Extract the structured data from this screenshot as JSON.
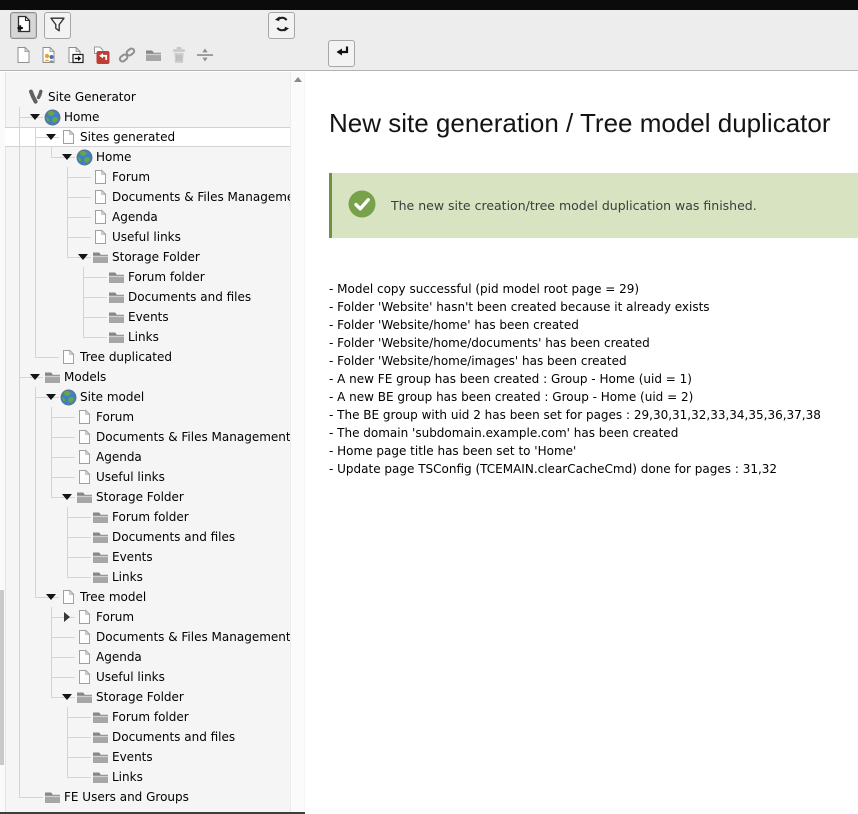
{
  "toolbar": {
    "primary_buttons": [
      {
        "icon": "new-page",
        "active": true
      },
      {
        "icon": "filter",
        "active": false
      }
    ],
    "refresh_button_icon": "refresh",
    "return_button_icon": "return",
    "drag_icons": [
      "page-plain",
      "page-content",
      "page-shortcut",
      "page-insert-red",
      "link",
      "folder",
      "trash",
      "separator"
    ]
  },
  "tree": {
    "items": [
      {
        "label": "Site Generator",
        "depth": 0,
        "icon": "typo3",
        "expander": "none",
        "selected": false
      },
      {
        "label": "Home",
        "depth": 1,
        "icon": "globe",
        "expander": "open",
        "selected": false
      },
      {
        "label": "Sites generated",
        "depth": 2,
        "icon": "page",
        "expander": "open",
        "selected": true
      },
      {
        "label": "Home",
        "depth": 3,
        "icon": "globe",
        "expander": "open",
        "selected": false
      },
      {
        "label": "Forum",
        "depth": 4,
        "icon": "page",
        "expander": "none",
        "selected": false
      },
      {
        "label": "Documents & Files Management",
        "depth": 4,
        "icon": "page",
        "expander": "none",
        "selected": false
      },
      {
        "label": "Agenda",
        "depth": 4,
        "icon": "page",
        "expander": "none",
        "selected": false
      },
      {
        "label": "Useful links",
        "depth": 4,
        "icon": "page",
        "expander": "none",
        "selected": false
      },
      {
        "label": "Storage Folder",
        "depth": 4,
        "icon": "folder",
        "expander": "open",
        "selected": false
      },
      {
        "label": "Forum folder",
        "depth": 5,
        "icon": "folder",
        "expander": "none",
        "selected": false
      },
      {
        "label": "Documents and files",
        "depth": 5,
        "icon": "folder",
        "expander": "none",
        "selected": false
      },
      {
        "label": "Events",
        "depth": 5,
        "icon": "folder",
        "expander": "none",
        "selected": false
      },
      {
        "label": "Links",
        "depth": 5,
        "icon": "folder",
        "expander": "none",
        "selected": false
      },
      {
        "label": "Tree duplicated",
        "depth": 2,
        "icon": "page",
        "expander": "none",
        "selected": false
      },
      {
        "label": "Models",
        "depth": 1,
        "icon": "folder",
        "expander": "open",
        "selected": false
      },
      {
        "label": "Site model",
        "depth": 2,
        "icon": "globe",
        "expander": "open",
        "selected": false
      },
      {
        "label": "Forum",
        "depth": 3,
        "icon": "page",
        "expander": "none",
        "selected": false
      },
      {
        "label": "Documents & Files Management",
        "depth": 3,
        "icon": "page",
        "expander": "none",
        "selected": false
      },
      {
        "label": "Agenda",
        "depth": 3,
        "icon": "page",
        "expander": "none",
        "selected": false
      },
      {
        "label": "Useful links",
        "depth": 3,
        "icon": "page",
        "expander": "none",
        "selected": false
      },
      {
        "label": "Storage Folder",
        "depth": 3,
        "icon": "folder",
        "expander": "open",
        "selected": false
      },
      {
        "label": "Forum folder",
        "depth": 4,
        "icon": "folder",
        "expander": "none",
        "selected": false
      },
      {
        "label": "Documents and files",
        "depth": 4,
        "icon": "folder",
        "expander": "none",
        "selected": false
      },
      {
        "label": "Events",
        "depth": 4,
        "icon": "folder",
        "expander": "none",
        "selected": false
      },
      {
        "label": "Links",
        "depth": 4,
        "icon": "folder",
        "expander": "none",
        "selected": false
      },
      {
        "label": "Tree model",
        "depth": 2,
        "icon": "page",
        "expander": "open",
        "selected": false
      },
      {
        "label": "Forum",
        "depth": 3,
        "icon": "page",
        "expander": "closed",
        "selected": false
      },
      {
        "label": "Documents & Files Management",
        "depth": 3,
        "icon": "page",
        "expander": "none",
        "selected": false
      },
      {
        "label": "Agenda",
        "depth": 3,
        "icon": "page",
        "expander": "none",
        "selected": false
      },
      {
        "label": "Useful links",
        "depth": 3,
        "icon": "page",
        "expander": "none",
        "selected": false
      },
      {
        "label": "Storage Folder",
        "depth": 3,
        "icon": "folder",
        "expander": "open",
        "selected": false
      },
      {
        "label": "Forum folder",
        "depth": 4,
        "icon": "folder",
        "expander": "none",
        "selected": false
      },
      {
        "label": "Documents and files",
        "depth": 4,
        "icon": "folder",
        "expander": "none",
        "selected": false
      },
      {
        "label": "Events",
        "depth": 4,
        "icon": "folder",
        "expander": "none",
        "selected": false
      },
      {
        "label": "Links",
        "depth": 4,
        "icon": "folder",
        "expander": "none",
        "selected": false
      },
      {
        "label": "FE Users and Groups",
        "depth": 1,
        "icon": "folder",
        "expander": "none",
        "selected": false
      }
    ]
  },
  "main": {
    "title": "New site generation / Tree model duplicator",
    "callout": {
      "type": "success",
      "icon": "check-circle",
      "message": "The new site creation/tree model duplication was finished."
    },
    "log_lines": [
      "- Model copy successful (pid model root page = 29)",
      "- Folder 'Website' hasn't been created because it already exists",
      "- Folder 'Website/home' has been created",
      "- Folder 'Website/home/documents' has been created",
      "- Folder 'Website/home/images' has been created",
      "- A new FE group has been created : Group - Home (uid = 1)",
      "- A new BE group has been created : Group - Home (uid = 2)",
      "- The BE group with uid 2 has been set for pages : 29,30,31,32,33,34,35,36,37,38",
      "- The domain 'subdomain.example.com' has been created",
      "- Home page title has been set to 'Home'",
      "- Update page TSConfig (TCEMAIN.clearCacheCmd) done for pages : 31,32"
    ]
  },
  "colors": {
    "success_bg": "#d7e3c1",
    "success_border": "#70923e",
    "success_icon": "#77a24b",
    "topbar": "#0b0b0b"
  }
}
